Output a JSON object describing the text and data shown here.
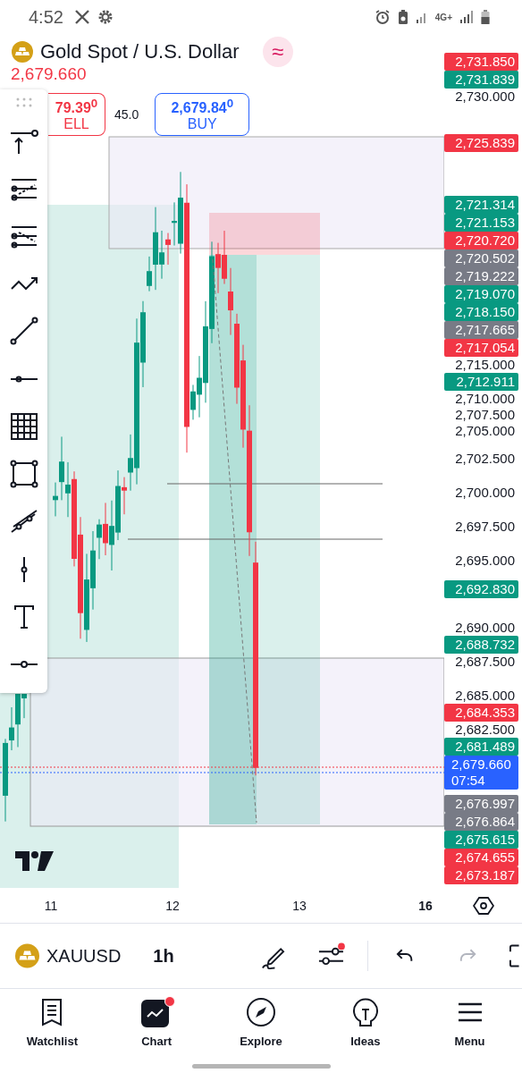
{
  "status_bar": {
    "time": "4:52",
    "network": "4G+"
  },
  "header": {
    "title": "Gold Spot / U.S. Dollar",
    "badge": "≈",
    "last_price": "2,679.660",
    "sell": {
      "price": "79.39$^{0}$",
      "label": "ELL"
    },
    "spread": "45.0",
    "buy": {
      "price": "2,679.84$^{0}$",
      "label": "BUY"
    }
  },
  "price_axis": [
    {
      "kind": "badge",
      "text": "2,731.850",
      "color": "#f23645"
    },
    {
      "kind": "badge",
      "text": "2,731.839",
      "color": "#089981"
    },
    {
      "kind": "tick",
      "text": "2,730.000"
    },
    {
      "kind": "badge",
      "text": "2,725.839",
      "color": "#f23645"
    },
    {
      "kind": "badge",
      "text": "2,721.314",
      "color": "#089981"
    },
    {
      "kind": "badge",
      "text": "2,721.153",
      "color": "#089981"
    },
    {
      "kind": "badge",
      "text": "2,720.720",
      "color": "#f23645"
    },
    {
      "kind": "badge",
      "text": "2,720.502",
      "color": "#787b86"
    },
    {
      "kind": "badge",
      "text": "2,719.222",
      "color": "#787b86"
    },
    {
      "kind": "badge",
      "text": "2,719.070",
      "color": "#089981"
    },
    {
      "kind": "badge",
      "text": "2,718.150",
      "color": "#089981"
    },
    {
      "kind": "badge",
      "text": "2,717.665",
      "color": "#787b86"
    },
    {
      "kind": "badge",
      "text": "2,717.054",
      "color": "#f23645"
    },
    {
      "kind": "tick",
      "text": "2,715.000"
    },
    {
      "kind": "badge",
      "text": "2,712.911",
      "color": "#089981"
    },
    {
      "kind": "tick",
      "text": "2,710.000"
    },
    {
      "kind": "tick",
      "text": "2,707.500"
    },
    {
      "kind": "tick",
      "text": "2,705.000"
    },
    {
      "kind": "tick",
      "text": "2,702.500"
    },
    {
      "kind": "tick",
      "text": "2,700.000"
    },
    {
      "kind": "tick",
      "text": "2,697.500"
    },
    {
      "kind": "tick",
      "text": "2,695.000"
    },
    {
      "kind": "badge",
      "text": "2,692.830",
      "color": "#089981"
    },
    {
      "kind": "tick",
      "text": "2,690.000"
    },
    {
      "kind": "badge",
      "text": "2,688.732",
      "color": "#089981"
    },
    {
      "kind": "tick",
      "text": "2,687.500"
    },
    {
      "kind": "tick",
      "text": "2,685.000"
    },
    {
      "kind": "badge",
      "text": "2,684.353",
      "color": "#f23645"
    },
    {
      "kind": "tick",
      "text": "2,682.500"
    },
    {
      "kind": "badge",
      "text": "2,681.489",
      "color": "#089981"
    },
    {
      "kind": "countdown",
      "text": "2,679.660",
      "sub": "07:54",
      "color": "#2962ff"
    },
    {
      "kind": "badge",
      "text": "2,676.997",
      "color": "#787b86"
    },
    {
      "kind": "badge",
      "text": "2,676.864",
      "color": "#787b86"
    },
    {
      "kind": "badge",
      "text": "2,675.615",
      "color": "#089981"
    },
    {
      "kind": "badge",
      "text": "2,674.655",
      "color": "#f23645"
    },
    {
      "kind": "badge",
      "text": "2,673.187",
      "color": "#f23645"
    }
  ],
  "time_axis": [
    {
      "label": "11",
      "bold": false
    },
    {
      "label": "12",
      "bold": false
    },
    {
      "label": "13",
      "bold": false
    },
    {
      "label": "16",
      "bold": true
    }
  ],
  "toolbar": {
    "symbol": "XAUUSD",
    "interval": "1h",
    "indicator_alert": true,
    "redo_disabled": true
  },
  "nav": [
    {
      "label": "Watchlist",
      "selected": false,
      "alert": false
    },
    {
      "label": "Chart",
      "selected": true,
      "alert": true
    },
    {
      "label": "Explore",
      "selected": false,
      "alert": false
    },
    {
      "label": "Ideas",
      "selected": false,
      "alert": false
    },
    {
      "label": "Menu",
      "selected": false,
      "alert": false
    }
  ]
}
